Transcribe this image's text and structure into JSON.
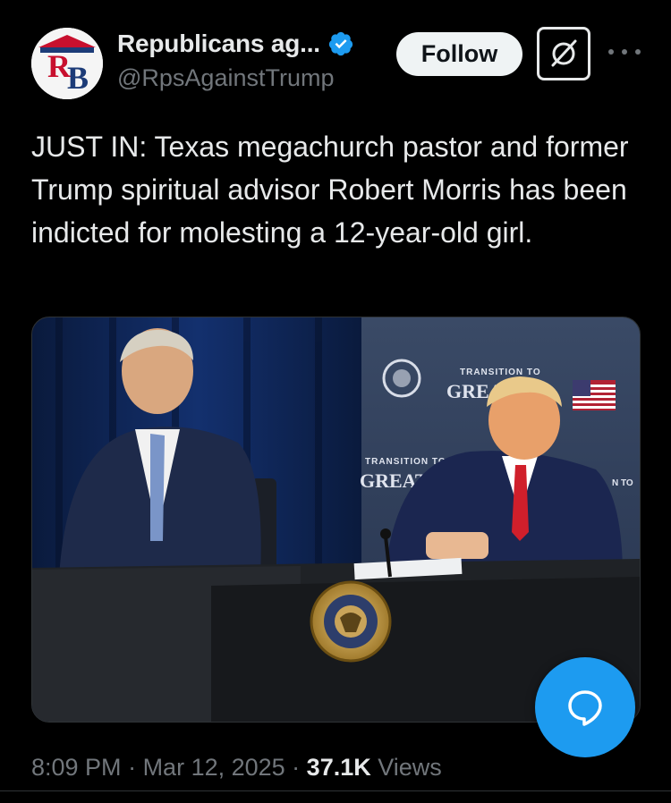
{
  "author": {
    "display_name": "Republicans ag...",
    "handle": "@RpsAgainstTrump",
    "avatar_letters": "RB",
    "verified": true
  },
  "actions": {
    "follow_label": "Follow"
  },
  "tweet": {
    "text": "JUST IN: Texas megachurch pastor and former Trump spiritual advisor Robert Morris has been indicted for molesting a 12-year-old girl."
  },
  "media": {
    "backdrop_line1": "TRANSITION TO",
    "backdrop_line2": "GREATNE",
    "banner_top_line1": "TRANSITION TO",
    "banner_top_line2": "GREATN",
    "right_edge_text": "N TO",
    "seal_text": "SEAL OF THE PRESIDENT OF THE UNITED STATES"
  },
  "meta": {
    "time": "8:09 PM",
    "separator": " · ",
    "date": "Mar 12, 2025",
    "views_count": "37.1K",
    "views_label": "Views"
  },
  "colors": {
    "accent": "#1d9bf0",
    "background": "#000000",
    "muted": "#71767b",
    "text": "#e7e9ea"
  }
}
